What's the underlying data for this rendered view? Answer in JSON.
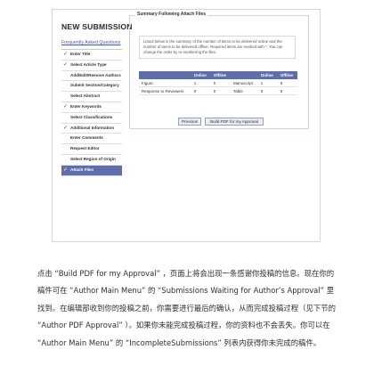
{
  "nav": {
    "title": "NEW SUBMISSION",
    "faq_link": "Frequently Asked Questions",
    "steps": [
      {
        "label": "Enter Title",
        "checked": true
      },
      {
        "label": "Select Article Type",
        "checked": true
      },
      {
        "label": "Add/Edit/Remove Authors",
        "checked": false
      },
      {
        "label": "Submit Section/Category",
        "checked": false
      },
      {
        "label": "Select Abstract",
        "checked": false
      },
      {
        "label": "Enter Keywords",
        "checked": true
      },
      {
        "label": "Select Classifications",
        "checked": false
      },
      {
        "label": "Additional Information",
        "checked": true
      },
      {
        "label": "Enter Comments",
        "checked": false
      },
      {
        "label": "Request Editor",
        "checked": false
      },
      {
        "label": "Select Region of Origin",
        "checked": false
      },
      {
        "label": "Attach Files",
        "checked": true,
        "active": true
      }
    ]
  },
  "panel": {
    "legend": "Summary Following Attach Files",
    "note": "Listed below is the summary of the number of items to be delivered online and the number of items to be delivered offline. Required items are marked with *. You can change the order by re-numbering the files.",
    "table": {
      "headers": [
        "",
        "Online",
        "Offline",
        "",
        "Online",
        "Offline"
      ],
      "rows": [
        [
          "Figure",
          "1",
          "0",
          "Manuscript",
          "1",
          "0"
        ],
        [
          "Response to Reviewers",
          "0",
          "0",
          "Table",
          "0",
          "0"
        ]
      ]
    },
    "buttons": {
      "previous": "Previous",
      "build_pdf": "Build PDF for my Approval"
    }
  },
  "paragraph": "点击 “Build PDF for my Approval” ，页面上将会出现一条感谢你投稿的信息。现在你的稿件可在 “Author Main Menu” 的 “Submissions Waiting for Author’s Approval” 里找到。在编辑部收到你的投稿之前，你需要进行最后的确认，从而完成投稿过程（见下节的 “Author PDF Approval” ）。如果你未能完成投稿过程，你的资料也不会丢失。你可以在 “Author Main Menu” 的 “IncompleteSubmissions” 列表内获得你未完成的稿件。"
}
